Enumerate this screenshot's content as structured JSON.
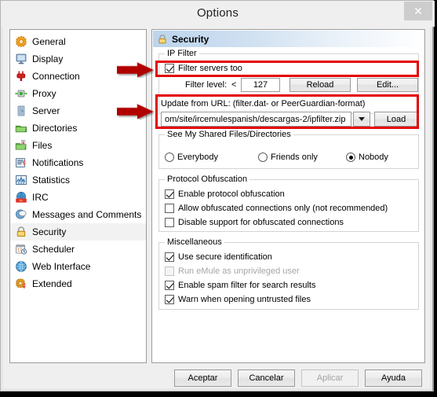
{
  "window": {
    "title": "Options",
    "close_icon": "close-icon"
  },
  "sidebar": {
    "items": [
      {
        "label": "General",
        "icon": "gear-orange-icon"
      },
      {
        "label": "Display",
        "icon": "monitor-icon"
      },
      {
        "label": "Connection",
        "icon": "plug-red-icon"
      },
      {
        "label": "Proxy",
        "icon": "proxy-icon"
      },
      {
        "label": "Server",
        "icon": "server-door-icon"
      },
      {
        "label": "Directories",
        "icon": "folder-green-icon"
      },
      {
        "label": "Files",
        "icon": "files-icon"
      },
      {
        "label": "Notifications",
        "icon": "notification-icon"
      },
      {
        "label": "Statistics",
        "icon": "statistics-icon"
      },
      {
        "label": "IRC",
        "icon": "irc-icon"
      },
      {
        "label": "Messages and Comments",
        "icon": "messages-icon"
      },
      {
        "label": "Security",
        "icon": "lock-icon",
        "selected": true
      },
      {
        "label": "Scheduler",
        "icon": "calendar-clock-icon"
      },
      {
        "label": "Web Interface",
        "icon": "globe-icon"
      },
      {
        "label": "Extended",
        "icon": "extended-gear-icon"
      }
    ]
  },
  "pane": {
    "header": {
      "title": "Security",
      "icon": "lock-icon"
    },
    "ip_filter": {
      "title": "IP Filter",
      "filter_servers_too": {
        "label": "Filter servers too",
        "checked": true
      },
      "filter_level_label": "Filter level:",
      "filter_level_operator": "<",
      "filter_level_value": "127",
      "reload_button": "Reload",
      "edit_button": "Edit...",
      "update_label": "Update from URL: (filter.dat- or PeerGuardian-format)",
      "url_value": "om/site/ircemulespanish/descargas-2/ipfilter.zip",
      "dropdown_icon": "chevron-down-icon",
      "load_button": "Load"
    },
    "shared": {
      "title": "See My Shared Files/Directories",
      "options": [
        {
          "label": "Everybody",
          "selected": false
        },
        {
          "label": "Friends only",
          "selected": false
        },
        {
          "label": "Nobody",
          "selected": true
        }
      ]
    },
    "obfuscation": {
      "title": "Protocol Obfuscation",
      "items": [
        {
          "label": "Enable protocol obfuscation",
          "checked": true,
          "disabled": false
        },
        {
          "label": "Allow obfuscated connections only (not recommended)",
          "checked": false,
          "disabled": false
        },
        {
          "label": "Disable support for obfuscated connections",
          "checked": false,
          "disabled": false
        }
      ]
    },
    "misc": {
      "title": "Miscellaneous",
      "items": [
        {
          "label": "Use secure identification",
          "checked": true,
          "disabled": false
        },
        {
          "label": "Run eMule as unprivileged user",
          "checked": false,
          "disabled": true
        },
        {
          "label": "Enable spam filter for search results",
          "checked": true,
          "disabled": false
        },
        {
          "label": "Warn when opening untrusted files",
          "checked": true,
          "disabled": false
        }
      ]
    }
  },
  "footer": {
    "buttons": [
      {
        "label": "Aceptar",
        "disabled": false
      },
      {
        "label": "Cancelar",
        "disabled": false
      },
      {
        "label": "Aplicar",
        "disabled": true
      },
      {
        "label": "Ayuda",
        "disabled": false
      }
    ]
  },
  "annotations": {
    "highlight_color": "#e40000",
    "arrow_color": "#b00000",
    "arrows": [
      {
        "name": "arrow-filter-servers"
      },
      {
        "name": "arrow-update-url"
      }
    ],
    "boxes": [
      {
        "name": "highlight-filter-servers"
      },
      {
        "name": "highlight-update-url"
      }
    ]
  }
}
